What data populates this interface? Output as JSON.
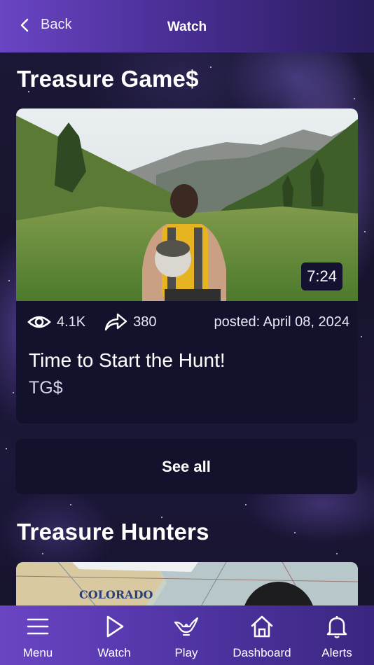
{
  "header": {
    "back_label": "Back",
    "title": "Watch"
  },
  "sections": [
    {
      "title": "Treasure Game$",
      "video": {
        "duration": "7:24",
        "views": "4.1K",
        "shares": "380",
        "posted": "posted: April 08, 2024",
        "title": "Time to Start the Hunt!",
        "channel": "TG$"
      },
      "see_all_label": "See all"
    },
    {
      "title": "Treasure Hunters",
      "map_text": "COLORADO"
    }
  ],
  "bottom_nav": [
    {
      "label": "Menu",
      "icon": "menu-icon"
    },
    {
      "label": "Watch",
      "icon": "play-icon"
    },
    {
      "label": "Play",
      "icon": "genie-lamp-icon"
    },
    {
      "label": "Dashboard",
      "icon": "home-icon"
    },
    {
      "label": "Alerts",
      "icon": "bell-icon"
    }
  ],
  "colors": {
    "header_gradient_start": "#6a45c4",
    "card_background": "#13122d",
    "page_background": "#17142e"
  }
}
